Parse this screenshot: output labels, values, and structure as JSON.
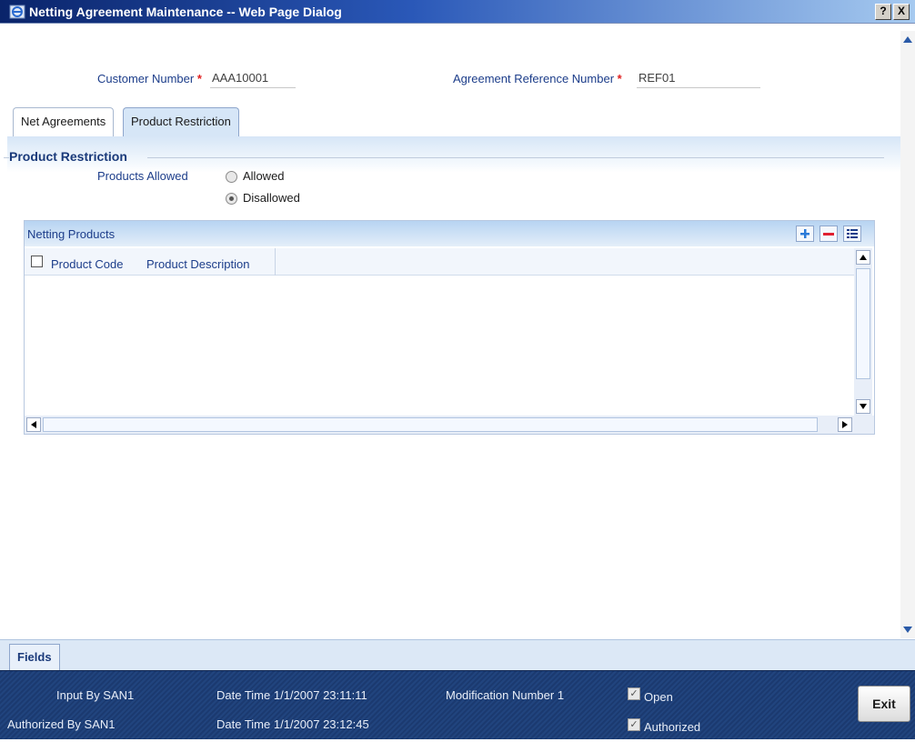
{
  "window": {
    "title": "Netting Agreement Maintenance -- Web Page Dialog",
    "help_glyph": "?",
    "close_glyph": "X"
  },
  "header_fields": {
    "customer_number_label": "Customer Number",
    "customer_number_value": "AAA10001",
    "agreement_ref_label": "Agreement Reference Number",
    "agreement_ref_value": "REF01",
    "required_mark": "*"
  },
  "tabs": [
    {
      "label": "Net Agreements",
      "active": false
    },
    {
      "label": "Product Restriction",
      "active": true
    }
  ],
  "product_restriction": {
    "section_title": "Product Restriction",
    "products_allowed_label": "Products Allowed",
    "options": [
      {
        "label": "Allowed",
        "checked": false
      },
      {
        "label": "Disallowed",
        "checked": true
      }
    ]
  },
  "grid": {
    "title": "Netting Products",
    "columns": [
      "Product Code",
      "Product Description"
    ],
    "rows": [],
    "buttons": [
      "add-row-icon",
      "delete-row-icon",
      "view-list-icon"
    ]
  },
  "footer": {
    "fields_tab": "Fields",
    "input_by": "Input By SAN1",
    "authorized_by": "Authorized By SAN1",
    "input_datetime": "Date Time 1/1/2007 23:11:11",
    "auth_datetime": "Date Time 1/1/2007 23:12:45",
    "modification": "Modification Number 1",
    "open_label": "Open",
    "authorized_label": "Authorized",
    "open_checked": true,
    "authorized_checked": true,
    "exit_label": "Exit"
  },
  "colors": {
    "title_bar": "#0a246a",
    "label_blue": "#1c3d8a",
    "required_red": "#e02020",
    "audit_bg": "#1b3a70"
  }
}
